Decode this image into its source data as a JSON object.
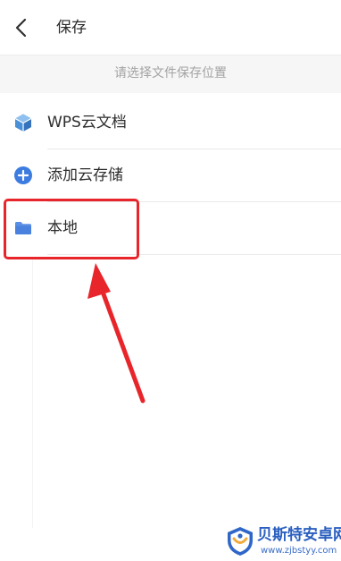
{
  "header": {
    "title": "保存"
  },
  "subtitle": "请选择文件保存位置",
  "options": [
    {
      "label": "WPS云文档",
      "icon": "cube-icon"
    },
    {
      "label": "添加云存储",
      "icon": "plus-circle-icon"
    },
    {
      "label": "本地",
      "icon": "folder-icon"
    }
  ],
  "watermark": {
    "name": "贝斯特安卓网",
    "url": "www.zjbstyy.com"
  },
  "colors": {
    "icon_blue": "#3c7be0",
    "cube_blue": "#4a90d6",
    "highlight_red": "#e8252a"
  }
}
